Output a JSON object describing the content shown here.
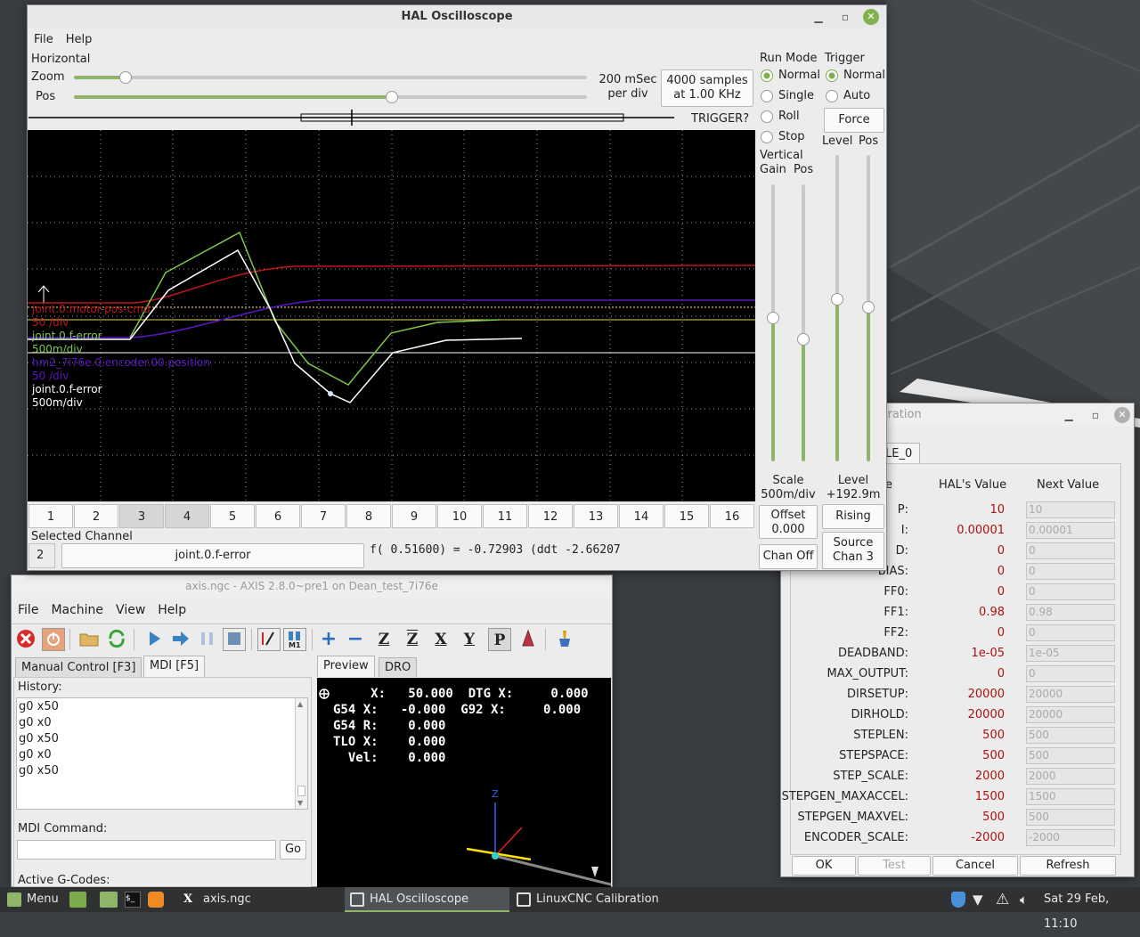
{
  "scope": {
    "title": "HAL Oscilloscope",
    "menu": [
      "File",
      "Help"
    ],
    "horizontal_label": "Horizontal",
    "zoom_label": "Zoom",
    "pos_label": "Pos",
    "zoom_level": 0.1,
    "pos_level": 0.62,
    "rate_line1": "200 mSec",
    "rate_line2": "per div",
    "samples_line1": "4000 samples",
    "samples_line2": "at 1.00 KHz",
    "trigger_status": "TRIGGER?",
    "run_mode_label": "Run Mode",
    "run_modes": [
      "Normal",
      "Single",
      "Roll",
      "Stop"
    ],
    "trigger_label": "Trigger",
    "trigger_modes": [
      "Normal",
      "Auto"
    ],
    "force_label": "Force",
    "level_label": "Level",
    "pos_short": "Pos",
    "vertical_label": "Vertical",
    "gain_label": "Gain",
    "scale_label": "Scale",
    "scale_value": "500m/div",
    "offset_label": "Offset",
    "offset_value": "0.000",
    "chan_off_label": "Chan Off",
    "level_caption": "Level",
    "level_value": "+192.9m",
    "rising_label": "Rising",
    "source_line1": "Source",
    "source_line2": "Chan 3",
    "channels": [
      "1",
      "2",
      "3",
      "4",
      "5",
      "6",
      "7",
      "8",
      "9",
      "10",
      "11",
      "12",
      "13",
      "14",
      "15",
      "16"
    ],
    "selected_channel_label": "Selected Channel",
    "selected_channel_number": "2",
    "selected_channel_name": "joint.0.f-error",
    "readout": "f( 0.51600) = -0.72903 (ddt -2.66207",
    "traces": [
      {
        "name": "joint.0.motor-pos-cmd",
        "scale": "50 /div",
        "color": "#c0151b"
      },
      {
        "name": "joint.0.f-error",
        "scale": "500m/div",
        "color": "#7cc84a"
      },
      {
        "name": "hm2_7i76e.0.encoder.00.position",
        "scale": "50 /div",
        "color": "#5a17c4"
      },
      {
        "name": "joint.0.f-error",
        "scale": "500m/div",
        "color": "#ffffff"
      }
    ]
  },
  "axis": {
    "title": "axis.ngc - AXIS 2.8.0~pre1 on Dean_test_7i76e",
    "menu": [
      "File",
      "Machine",
      "View",
      "Help"
    ],
    "tabs_left": [
      "Manual Control [F3]",
      "MDI [F5]"
    ],
    "tabs_right": [
      "Preview",
      "DRO"
    ],
    "history_label": "History:",
    "history": [
      "g0 x50",
      "g0 x0",
      "g0 x50",
      "g0 x0",
      "g0 x50"
    ],
    "mdi_label": "MDI Command:",
    "go_label": "Go",
    "active_gcodes_label": "Active G-Codes:",
    "dro": [
      "     X:   50.000  DTG X:     0.000",
      "G54 X:   -0.000  G92 X:     0.000",
      "G54 R:    0.000",
      "TLO X:    0.000",
      "  Vel:    0.000"
    ],
    "axis_z_label": "Z"
  },
  "calibration": {
    "title": "LinuxCNC Calibration",
    "title_visible": "libration",
    "tab_visible": "LE_0",
    "header_name_visible": "e",
    "header_hal": "HAL's Value",
    "header_next": "Next Value",
    "rows": [
      {
        "name": "P:",
        "hal": "10",
        "next": "10"
      },
      {
        "name": "I:",
        "hal": "0.00001",
        "next": "0.00001"
      },
      {
        "name": "D:",
        "hal": "0",
        "next": "0"
      },
      {
        "name": "BIAS:",
        "hal": "0",
        "next": "0"
      },
      {
        "name": "FF0:",
        "hal": "0",
        "next": "0"
      },
      {
        "name": "FF1:",
        "hal": "0.98",
        "next": "0.98"
      },
      {
        "name": "FF2:",
        "hal": "0",
        "next": "0"
      },
      {
        "name": "DEADBAND:",
        "hal": "1e-05",
        "next": "1e-05"
      },
      {
        "name": "MAX_OUTPUT:",
        "hal": "0",
        "next": "0"
      },
      {
        "name": "DIRSETUP:",
        "hal": "20000",
        "next": "20000"
      },
      {
        "name": "DIRHOLD:",
        "hal": "20000",
        "next": "20000"
      },
      {
        "name": "STEPLEN:",
        "hal": "500",
        "next": "500"
      },
      {
        "name": "STEPSPACE:",
        "hal": "500",
        "next": "500"
      },
      {
        "name": "STEP_SCALE:",
        "hal": "2000",
        "next": "2000"
      },
      {
        "name": "STEPGEN_MAXACCEL:",
        "hal": "1500",
        "next": "1500"
      },
      {
        "name": "STEPGEN_MAXVEL:",
        "hal": "500",
        "next": "500"
      },
      {
        "name": "ENCODER_SCALE:",
        "hal": "-2000",
        "next": "-2000"
      }
    ],
    "buttons": [
      "OK",
      "Test",
      "Cancel",
      "Refresh"
    ]
  },
  "taskbar": {
    "menu_label": "Menu",
    "items": [
      "axis.ngc",
      "HAL Oscilloscope",
      "LinuxCNC Calibration"
    ],
    "clock": "Sat 29 Feb, 11:10"
  }
}
